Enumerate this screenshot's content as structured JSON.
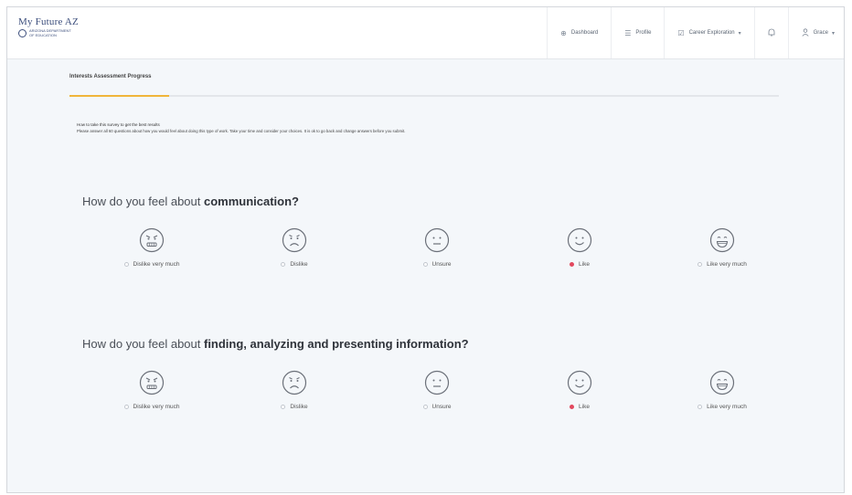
{
  "brand": {
    "title": "My Future AZ",
    "subtitle": "ARIZONA DEPARTMENT OF EDUCATION"
  },
  "nav": {
    "dashboard": "Dashboard",
    "profile": "Profile",
    "career_exploration": "Career Exploration",
    "user": "Grace"
  },
  "progress": {
    "title": "Interests Assessment Progress",
    "percent": 14
  },
  "help": {
    "title": "How to take this survey to get the best results",
    "body": "Please answer all 60 questions about how you would feel about doing this type of work. Take your time and consider your choices. It is ok to go back and change answers before you submit."
  },
  "questions": [
    {
      "prefix": "How do you feel about ",
      "topic": "communication?",
      "selected": 3,
      "options": [
        {
          "label": "Dislike very much",
          "icon": "angry-face-icon"
        },
        {
          "label": "Dislike",
          "icon": "sad-face-icon"
        },
        {
          "label": "Unsure",
          "icon": "neutral-face-icon"
        },
        {
          "label": "Like",
          "icon": "smile-face-icon"
        },
        {
          "label": "Like very much",
          "icon": "grin-face-icon"
        }
      ]
    },
    {
      "prefix": "How do you feel about ",
      "topic": "finding, analyzing and presenting information?",
      "selected": 3,
      "options": [
        {
          "label": "Dislike very much",
          "icon": "angry-face-icon"
        },
        {
          "label": "Dislike",
          "icon": "sad-face-icon"
        },
        {
          "label": "Unsure",
          "icon": "neutral-face-icon"
        },
        {
          "label": "Like",
          "icon": "smile-face-icon"
        },
        {
          "label": "Like very much",
          "icon": "grin-face-icon"
        }
      ]
    }
  ],
  "colors": {
    "accent": "#f0b53a",
    "selected": "#e2495f",
    "brand": "#3d4f7d"
  }
}
